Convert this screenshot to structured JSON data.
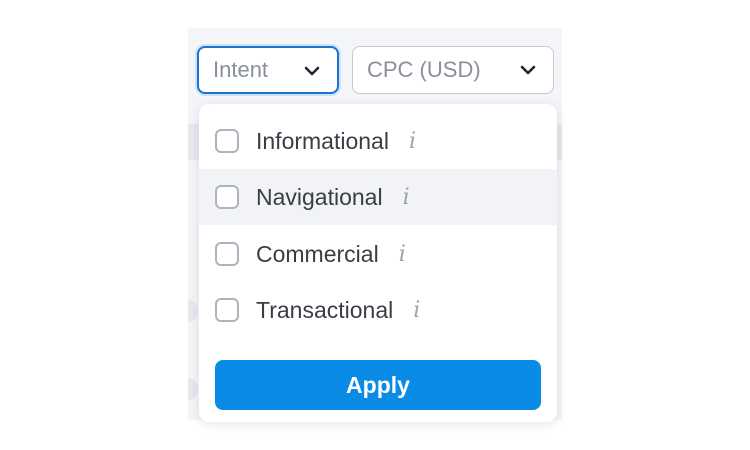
{
  "filters": {
    "intent": {
      "label": "Intent",
      "chevron_icon": "chevron-down-icon"
    },
    "cpc": {
      "label": "CPC (USD)",
      "chevron_icon": "chevron-down-icon"
    }
  },
  "intent_dropdown": {
    "options": [
      {
        "label": "Informational",
        "checked": false,
        "info_icon": "i"
      },
      {
        "label": "Navigational",
        "checked": false,
        "info_icon": "i"
      },
      {
        "label": "Commercial",
        "checked": false,
        "info_icon": "i"
      },
      {
        "label": "Transactional",
        "checked": false,
        "info_icon": "i"
      }
    ],
    "apply_label": "Apply"
  },
  "colors": {
    "accent": "#0a8be6",
    "focus_border": "#1a73d1",
    "hover_row": "#f2f3f7"
  }
}
